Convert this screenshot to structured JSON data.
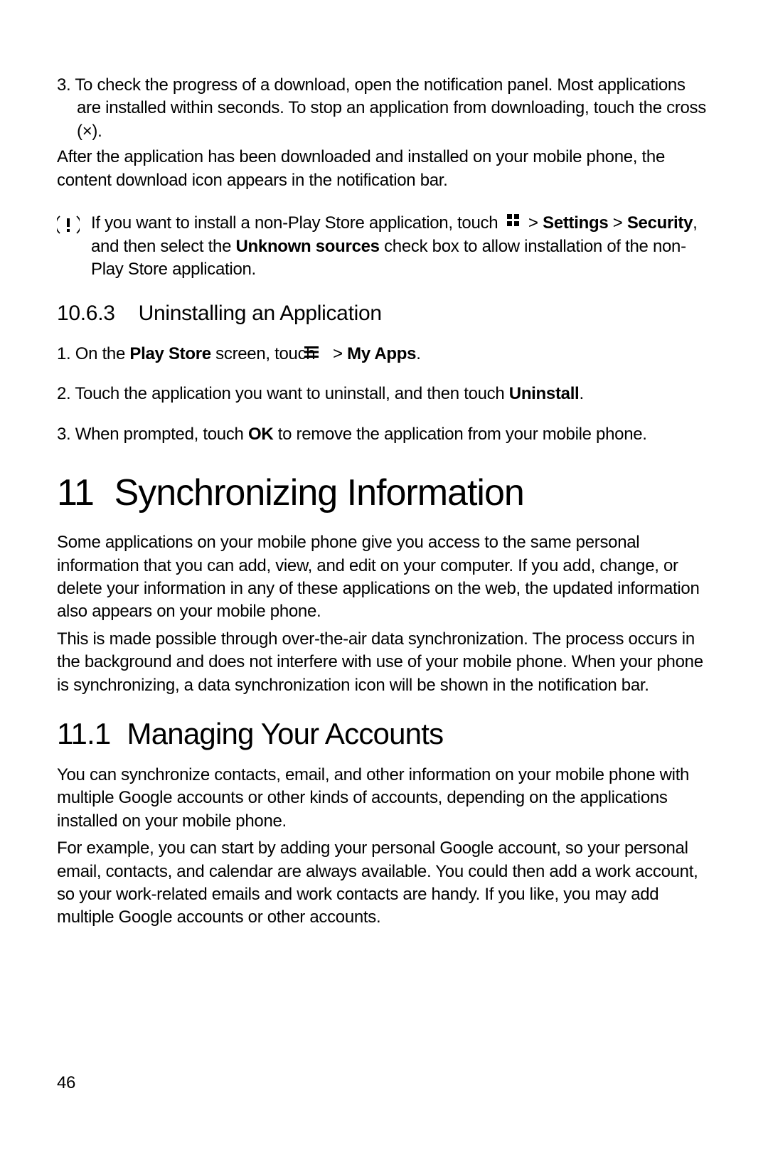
{
  "top_item3_a": "3. To check the progress of a download, open the notification panel. Most applications are installed within seconds. To stop an application from downloading, touch the cross (×).",
  "after_install": "After the application has been downloaded and installed on your mobile phone, the content download icon appears in the notification bar.",
  "note_prefix": "If you want to install a non-Play Store application, touch ",
  "note_gt1": " > ",
  "note_settings": "Settings",
  "note_gt2": " > ",
  "note_security": "Security",
  "note_mid": ", and then select the ",
  "note_unknown": "Unknown sources",
  "note_suffix": " check box to allow installation of the non-Play Store application.",
  "h_uninstall_num": "10.6.3",
  "h_uninstall_text": "Uninstalling an Application",
  "uninstall_1_prefix": "1. On the ",
  "uninstall_1_playstore": "Play Store",
  "uninstall_1_mid": " screen, touch ",
  "uninstall_1_gt": " > ",
  "uninstall_1_myapps": "My Apps",
  "uninstall_1_end": ".",
  "uninstall_2_a": "2. Touch the application you want to uninstall, and then touch ",
  "uninstall_2_bold": "Uninstall",
  "uninstall_2_end": ".",
  "uninstall_3_a": "3. When prompted, touch ",
  "uninstall_3_bold": "OK",
  "uninstall_3_b": " to remove the application from your mobile phone.",
  "h1_num": "11",
  "h1_text": "Synchronizing Information",
  "sync_p1": "Some applications on your mobile phone give you access to the same personal information that you can add, view, and edit on your computer. If you add, change, or delete your information in any of these applications on the web, the updated information also appears on your mobile phone.",
  "sync_p2": "This is made possible through over-the-air data synchronization. The process occurs in the background and does not interfere with use of your mobile phone. When your phone is synchronizing, a data synchronization icon will be shown in the notification bar.",
  "h2_num": "11.1",
  "h2_text": "Managing Your Accounts",
  "acct_p1": "You can synchronize contacts, email, and other information on your mobile phone with multiple Google accounts or other kinds of accounts, depending on the applications installed on your mobile phone.",
  "acct_p2": "For example, you can start by adding your personal Google account, so your personal email, contacts, and calendar are always available. You could then add a work account, so your work-related emails and work contacts are handy. If you like, you may add multiple Google accounts or other accounts.",
  "page_number": "46"
}
